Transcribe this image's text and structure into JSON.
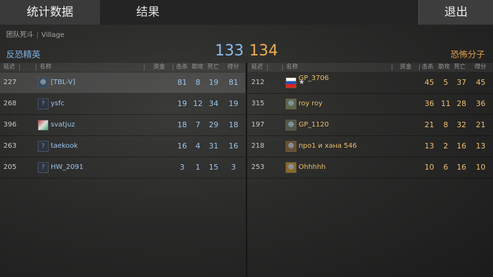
{
  "tabs": {
    "stats": "统计数据",
    "results": "结果"
  },
  "exit_label": "退出",
  "match": {
    "mode": "团队死斗",
    "separator": "|",
    "map": "Village"
  },
  "ct": {
    "name": "反恐精英",
    "score": "133",
    "color": "#8cbdf0"
  },
  "t": {
    "name": "恐怖分子",
    "score": "134",
    "color": "#f0ae52"
  },
  "columns": {
    "ping": "延迟",
    "name": "名称",
    "money": "资金",
    "kills": "击杀",
    "assists": "助攻",
    "deaths": "死亡",
    "score": "得分"
  },
  "ct_players": [
    {
      "ping": "227",
      "name": "[TBL-V]",
      "kills": "81",
      "assists": "8",
      "deaths": "19",
      "score": "81",
      "avatar": "portrait-avatar"
    },
    {
      "ping": "268",
      "name": "ysfc",
      "kills": "19",
      "assists": "12",
      "deaths": "34",
      "score": "19",
      "avatar": "unknown-avatar"
    },
    {
      "ping": "396",
      "name": "svatjuz",
      "kills": "18",
      "assists": "7",
      "deaths": "29",
      "score": "18",
      "avatar": "flag-avatar"
    },
    {
      "ping": "263",
      "name": "taekook",
      "kills": "16",
      "assists": "4",
      "deaths": "31",
      "score": "16",
      "avatar": "unknown-avatar"
    },
    {
      "ping": "205",
      "name": "HW_2091",
      "kills": "3",
      "assists": "1",
      "deaths": "15",
      "score": "3",
      "avatar": "unknown-avatar"
    }
  ],
  "t_players": [
    {
      "ping": "212",
      "name": "GP_3706",
      "badge": "★",
      "kills": "45",
      "assists": "5",
      "deaths": "37",
      "score": "45",
      "avatar": "russia-flag-avatar"
    },
    {
      "ping": "315",
      "name": "roy roy",
      "kills": "36",
      "assists": "11",
      "deaths": "28",
      "score": "36",
      "avatar": "character-avatar"
    },
    {
      "ping": "197",
      "name": "GP_1120",
      "kills": "21",
      "assists": "8",
      "deaths": "32",
      "score": "21",
      "avatar": "character-avatar"
    },
    {
      "ping": "218",
      "name": "про1 и хана 546",
      "kills": "13",
      "assists": "2",
      "deaths": "16",
      "score": "13",
      "avatar": "character-avatar"
    },
    {
      "ping": "253",
      "name": "Ohhhhh",
      "kills": "10",
      "assists": "6",
      "deaths": "16",
      "score": "10",
      "avatar": "character-avatar"
    }
  ]
}
